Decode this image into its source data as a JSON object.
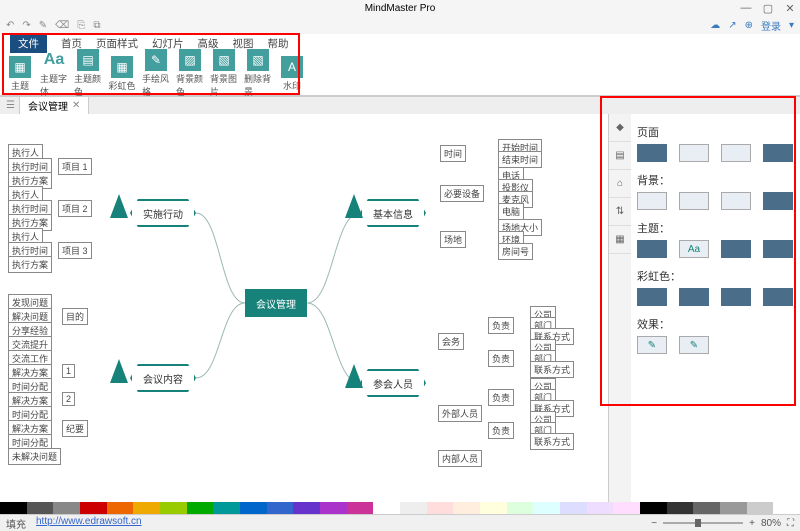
{
  "app": {
    "title": "MindMaster Pro"
  },
  "win": {
    "min": "—",
    "max": "▢",
    "close": "✕"
  },
  "top_right": {
    "login": "登录",
    "login_icon": "⊕"
  },
  "qat": [
    "↶",
    "↷",
    "✎",
    "⌫",
    "⎘",
    "⧉"
  ],
  "tabs": [
    "文件",
    "首页",
    "页面样式",
    "幻灯片",
    "高级",
    "视图",
    "帮助"
  ],
  "active_tab": "文件",
  "ribbon": [
    {
      "label": "主题",
      "glyph": "▦"
    },
    {
      "label": "主题字体",
      "glyph": "Aa",
      "aa": true
    },
    {
      "label": "主题颜色",
      "glyph": "▤"
    },
    {
      "label": "彩虹色",
      "glyph": "▦"
    },
    {
      "label": "手绘风格",
      "glyph": "✎"
    },
    {
      "label": "背景颜色",
      "glyph": "▨"
    },
    {
      "label": "背景图片",
      "glyph": "▧"
    },
    {
      "label": "删除背景",
      "glyph": "▧"
    },
    {
      "label": "水印",
      "glyph": "A"
    }
  ],
  "doc_tab": {
    "name": "会议管理",
    "close": "✕"
  },
  "mind": {
    "center": "会议管理",
    "branches": {
      "tl": {
        "label": "实施行动",
        "leaves": [
          {
            "k": "执行人"
          },
          {
            "k": "执行时间",
            "v": "项目 1"
          },
          {
            "k": "执行方案"
          },
          {
            "k": "执行人"
          },
          {
            "k": "执行时间",
            "v": "项目 2"
          },
          {
            "k": "执行方案"
          },
          {
            "k": "执行人"
          },
          {
            "k": "执行时间",
            "v": "项目 3"
          },
          {
            "k": "执行方案"
          }
        ]
      },
      "bl": {
        "label": "会议内容",
        "leaves": [
          {
            "k": "发现问题"
          },
          {
            "k": "解决问题",
            "v": "目的"
          },
          {
            "k": "分享经验"
          },
          {
            "k": "交流提升"
          },
          {
            "k": "交流工作"
          },
          {
            "k": "解决方案",
            "v": "1"
          },
          {
            "k": "时间分配"
          },
          {
            "k": "解决方案",
            "v": "2"
          },
          {
            "k": "时间分配"
          },
          {
            "k": "解决方案",
            "v": "纪要"
          },
          {
            "k": "时间分配"
          },
          {
            "k": "未解决问题"
          }
        ]
      },
      "tr": {
        "label": "基本信息",
        "leaves": [
          {
            "k": "时间",
            "c": [
              "开始时间",
              "结束时间"
            ]
          },
          {
            "k": "必要设备",
            "c": [
              "电话",
              "投影仪",
              "麦克风",
              "电脑"
            ]
          },
          {
            "k": "场地",
            "c": [
              "场地大小",
              "环境",
              "房间号"
            ]
          }
        ]
      },
      "br": {
        "label": "参会人员",
        "leaves": [
          {
            "k": "会务",
            "sub": [
              {
                "k": "负责",
                "c": [
                  "公司",
                  "部门",
                  "联系方式"
                ]
              },
              {
                "k": "负责",
                "c": [
                  "公司",
                  "部门",
                  "联系方式"
                ]
              }
            ]
          },
          {
            "k": "外部人员",
            "sub": [
              {
                "k": "负责",
                "c": [
                  "公司",
                  "部门",
                  "联系方式"
                ]
              },
              {
                "k": "负责",
                "c": [
                  "公司",
                  "部门",
                  "联系方式"
                ]
              }
            ]
          },
          {
            "k": "内部人员"
          }
        ]
      }
    }
  },
  "side": {
    "title": "页面",
    "sections": {
      "bg": "背景：",
      "theme": "主题：",
      "rainbow": "彩虹色：",
      "effect": "效果："
    }
  },
  "status": {
    "left": "填充",
    "url": "http://www.edrawsoft.cn",
    "zoom": "80%",
    "fit": "⛶"
  },
  "palette": [
    "#000",
    "#555",
    "#888",
    "#c00",
    "#e60",
    "#ea0",
    "#9c0",
    "#0a0",
    "#099",
    "#06c",
    "#36c",
    "#63c",
    "#a3c",
    "#c39",
    "#fff",
    "#eee",
    "#fdd",
    "#fed",
    "#ffd",
    "#dfd",
    "#dff",
    "#ddf",
    "#edf",
    "#fdf",
    "#000",
    "#333",
    "#666",
    "#999",
    "#ccc",
    "#fff"
  ]
}
